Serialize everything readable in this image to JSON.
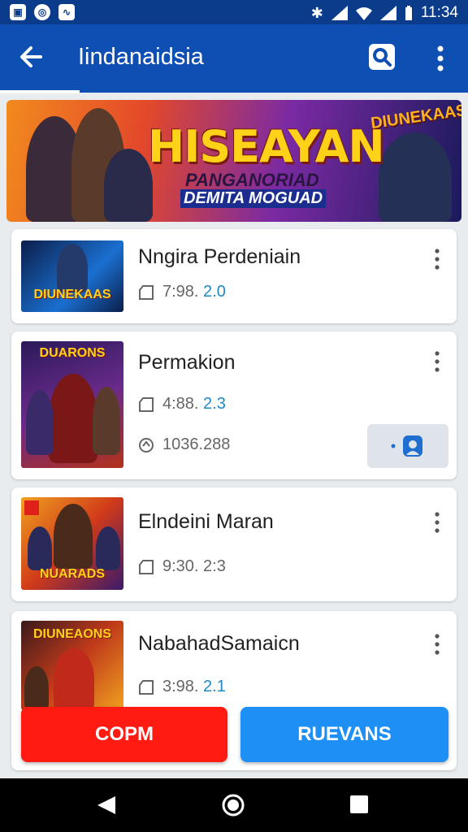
{
  "status_bar": {
    "time": "11:34"
  },
  "app_bar": {
    "title": "Iindanaidsia"
  },
  "banner": {
    "title": "HISEAYAN",
    "subtitle": "PANGANORIAD",
    "tagline": "DEMITA MOGUAD",
    "badge": "DIUNEKAAS"
  },
  "items": [
    {
      "title": "Nngira Perdeniain",
      "thumb_text": "DIUNEKAAS",
      "size": "7:98.",
      "size_accent": "2.0"
    },
    {
      "title": "Permakion",
      "thumb_text": "DUARONS",
      "size": "4:88.",
      "size_accent": "2.3",
      "downloads": "1036.288"
    },
    {
      "title": "Elndeini Maran",
      "thumb_text": "NUARADS",
      "size": "9:30. 2:3",
      "size_accent": ""
    },
    {
      "title": "NabahadSamaicn",
      "thumb_text": "DIUNEAONS",
      "size": "3:98.",
      "size_accent": "2.1"
    }
  ],
  "actions": {
    "left_label": "COPM",
    "right_label": "RUEVANS"
  },
  "colors": {
    "primary": "#0e4fb4",
    "status": "#0b3c8c",
    "red_button": "#ff1a12",
    "blue_button": "#1e8ff5",
    "accent_text": "#1e88c8"
  }
}
